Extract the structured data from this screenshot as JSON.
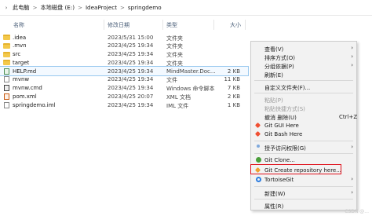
{
  "breadcrumb": {
    "items": [
      "此电脑",
      "本地磁盘 (E:)",
      "IdeaProject",
      "springdemo"
    ],
    "separator": ">"
  },
  "columns": {
    "name": "名称",
    "date": "修改日期",
    "type": "类型",
    "size": "大小"
  },
  "files": [
    {
      "name": ".idea",
      "date": "2023/5/31 15:00",
      "type": "文件夹",
      "size": "",
      "kind": "folder",
      "icon": "folder-icon"
    },
    {
      "name": ".mvn",
      "date": "2023/4/25 19:34",
      "type": "文件夹",
      "size": "",
      "kind": "folder",
      "icon": "folder-icon"
    },
    {
      "name": "src",
      "date": "2023/4/25 19:34",
      "type": "文件夹",
      "size": "",
      "kind": "folder",
      "icon": "folder-icon"
    },
    {
      "name": "target",
      "date": "2023/4/25 19:34",
      "type": "文件夹",
      "size": "",
      "kind": "folder",
      "icon": "folder-icon"
    },
    {
      "name": "HELP.md",
      "date": "2023/4/25 19:34",
      "type": "MindMaster.Doc...",
      "size": "2 KB",
      "kind": "md",
      "icon": "markdown-file-icon"
    },
    {
      "name": "mvnw",
      "date": "2023/4/25 19:34",
      "type": "文件",
      "size": "11 KB",
      "kind": "file",
      "icon": "file-icon"
    },
    {
      "name": "mvnw.cmd",
      "date": "2023/4/25 19:34",
      "type": "Windows 命令脚本",
      "size": "7 KB",
      "kind": "cmd",
      "icon": "cmd-file-icon"
    },
    {
      "name": "pom.xml",
      "date": "2023/4/25 20:07",
      "type": "XML 文档",
      "size": "2 KB",
      "kind": "xml",
      "icon": "xml-file-icon"
    },
    {
      "name": "springdemo.iml",
      "date": "2023/4/25 19:34",
      "type": "IML 文件",
      "size": "1 KB",
      "kind": "file",
      "icon": "file-icon"
    }
  ],
  "menu": {
    "view": "查看(V)",
    "sort": "排序方式(O)",
    "group": "分组依据(P)",
    "refresh": "刷新(E)",
    "customize": "自定义文件夹(F)...",
    "paste": "粘贴(P)",
    "paste_shortcut": "粘贴快捷方式(S)",
    "undo_delete": "撤消 删除(U)",
    "undo_shortcut": "Ctrl+Z",
    "git_gui": "Git GUI Here",
    "git_bash": "Git Bash Here",
    "grant_access": "授予访问权限(G)",
    "git_clone": "Git Clone...",
    "git_create_repo": "Git Create repository here...",
    "tortoise": "TortoiseGit",
    "new": "新建(W)",
    "properties": "属性(R)"
  },
  "watermark": "CSDN @..."
}
